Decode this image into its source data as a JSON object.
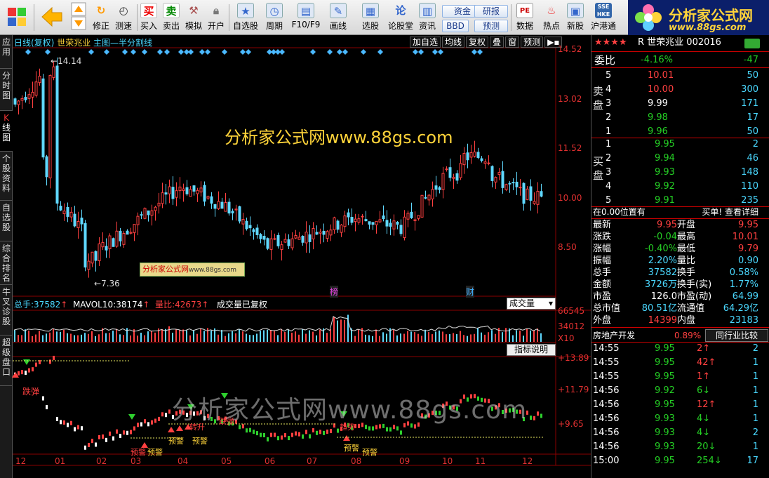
{
  "toolbar": {
    "buttons": [
      {
        "label": "",
        "icon": "windows-icon"
      },
      {
        "label": "",
        "icon": "back-arrow-icon"
      },
      {
        "label": "",
        "icon": "up-down-icon"
      },
      {
        "label": "修正",
        "icon": "refresh-icon"
      },
      {
        "label": "测速",
        "icon": "clock-icon"
      },
      {
        "label": "买入",
        "icon": "buy-icon"
      },
      {
        "label": "卖出",
        "icon": "sell-icon"
      },
      {
        "label": "模拟",
        "icon": "hammer-icon"
      },
      {
        "label": "开户",
        "icon": "lock-icon"
      },
      {
        "label": "自选股",
        "icon": "star-icon"
      },
      {
        "label": "周期",
        "icon": "period-icon"
      },
      {
        "label": "F10/F9",
        "icon": "f10-icon"
      },
      {
        "label": "画线",
        "icon": "draw-line-icon"
      },
      {
        "label": "选股",
        "icon": "select-stock-icon"
      },
      {
        "label": "论股堂",
        "icon": "forum-icon"
      },
      {
        "label": "资讯",
        "icon": "news-icon"
      },
      {
        "label": "数据",
        "icon": "pe-icon"
      },
      {
        "label": "热点",
        "icon": "hot-icon"
      },
      {
        "label": "新股",
        "icon": "new-stock-icon"
      },
      {
        "label": "沪港通",
        "icon": "sse-hk-icon"
      }
    ],
    "funds_btn": "资金",
    "research_btn": "研报",
    "bbd_btn": "BBD",
    "forecast_btn": "预测"
  },
  "logo": {
    "title": "分析家公式网",
    "url": "www.88gs.com"
  },
  "lefttabs": [
    "应用",
    "分时图",
    "K线图",
    "个股资料",
    "自选股",
    "综合排名",
    "牛叉诊股",
    "超级盘口"
  ],
  "chart": {
    "header_left": "日线(复权)",
    "stock_name": "世荣兆业",
    "main_chart_label": "主图—半分割线",
    "tools": [
      "加自选",
      "均线",
      "复权",
      "叠",
      "窗",
      "预测"
    ],
    "overlay_watermark": "分析家公式网www.88gs.com",
    "stamp_text": "分析家公式网",
    "stamp_url": "www.88gs.com",
    "y_price_labels": [
      "14.52",
      "13.02",
      "11.52",
      "10.00",
      "8.50"
    ],
    "high_label": "14.14",
    "low_label": "7.36",
    "event_marks": [
      "榜",
      "财"
    ],
    "vol_header": {
      "total_label": "总手:",
      "total_value": "37582",
      "mavol_label": "MAVOL10:",
      "mavol_value": "38174",
      "ratio_label": "量比:",
      "ratio_value": "42673",
      "note": "成交量已复权"
    },
    "vol_dropdown": "成交量",
    "vol_axis": [
      "66545",
      "34012",
      "X10"
    ],
    "indicator_button": "指标说明",
    "ind_axis": [
      "+13.89",
      "+11.79",
      "+9.65"
    ],
    "ind_watermark": "分析家公式网www.88gs.com",
    "ind_texts": [
      "跌弹",
      "预警",
      "预警",
      "预警",
      "转升",
      "预警",
      "趋势",
      "预警",
      "预警",
      "跌弹"
    ],
    "x_months": [
      "12",
      "01",
      "02",
      "03",
      "04",
      "05",
      "06",
      "07",
      "08",
      "09",
      "10",
      "11",
      "12"
    ]
  },
  "chart_data": {
    "type": "candlestick",
    "series": [
      {
        "name": "price",
        "x_axis": "months 12..12",
        "ylim": [
          7.36,
          14.52
        ],
        "monthly_close_approx": [
          13.0,
          9.8,
          8.3,
          9.1,
          10.3,
          9.7,
          8.4,
          8.8,
          9.3,
          9.0,
          10.6,
          10.9,
          9.95
        ]
      }
    ]
  },
  "quote": {
    "header": "R 世荣兆业 002016",
    "rating_stars": "★★★★",
    "weibi_label": "委比",
    "weibi_pct": "-4.16%",
    "weibi_val": "-47",
    "sell_label": "卖盘",
    "buy_label": "买盘",
    "asks": [
      {
        "lvl": "5",
        "price": "10.01",
        "vol": "50"
      },
      {
        "lvl": "4",
        "price": "10.00",
        "vol": "300"
      },
      {
        "lvl": "3",
        "price": "9.99",
        "vol": "171"
      },
      {
        "lvl": "2",
        "price": "9.98",
        "vol": "17"
      },
      {
        "lvl": "1",
        "price": "9.96",
        "vol": "50"
      }
    ],
    "bids": [
      {
        "lvl": "1",
        "price": "9.95",
        "vol": "2"
      },
      {
        "lvl": "2",
        "price": "9.94",
        "vol": "46"
      },
      {
        "lvl": "3",
        "price": "9.93",
        "vol": "148"
      },
      {
        "lvl": "4",
        "price": "9.92",
        "vol": "110"
      },
      {
        "lvl": "5",
        "price": "9.91",
        "vol": "235"
      }
    ],
    "notice_left": "在0.00位置有",
    "notice_right": "买单! 查看详细",
    "stats": [
      [
        "最新",
        "9.95",
        "开盘",
        "9.95"
      ],
      [
        "涨跌",
        "-0.04",
        "最高",
        "10.01"
      ],
      [
        "涨幅",
        "-0.40%",
        "最低",
        "9.79"
      ],
      [
        "振幅",
        "2.20%",
        "量比",
        "0.90"
      ],
      [
        "总手",
        "37582",
        "换手",
        "0.58%"
      ],
      [
        "金额",
        "3726万",
        "换手(实)",
        "1.77%"
      ],
      [
        "市盈",
        "126.0",
        "市盈(动)",
        "64.99"
      ],
      [
        "总市值",
        "80.51亿",
        "流通值",
        "64.29亿"
      ],
      [
        "外盘",
        "14399",
        "内盘",
        "23183"
      ]
    ],
    "industry_name": "房地产开发",
    "industry_pct": "0.89%",
    "industry_btn": "同行业比较",
    "ticks": [
      {
        "time": "14:55",
        "price": "9.95",
        "vol": "2",
        "dir": "up",
        "n": "2"
      },
      {
        "time": "14:55",
        "price": "9.95",
        "vol": "42",
        "dir": "up",
        "n": "1"
      },
      {
        "time": "14:55",
        "price": "9.95",
        "vol": "1",
        "dir": "up",
        "n": "1"
      },
      {
        "time": "14:56",
        "price": "9.92",
        "vol": "6",
        "dir": "down",
        "n": "1"
      },
      {
        "time": "14:56",
        "price": "9.95",
        "vol": "12",
        "dir": "up",
        "n": "1"
      },
      {
        "time": "14:56",
        "price": "9.93",
        "vol": "4",
        "dir": "down",
        "n": "1"
      },
      {
        "time": "14:56",
        "price": "9.93",
        "vol": "4",
        "dir": "down",
        "n": "2"
      },
      {
        "time": "14:56",
        "price": "9.93",
        "vol": "20",
        "dir": "down",
        "n": "1"
      },
      {
        "time": "15:00",
        "price": "9.95",
        "vol": "254",
        "dir": "down",
        "n": "17"
      }
    ]
  },
  "colors": {
    "up": "#ff4040",
    "down": "#25d0ff",
    "accent": "#ffd43a",
    "bg": "#000000"
  }
}
